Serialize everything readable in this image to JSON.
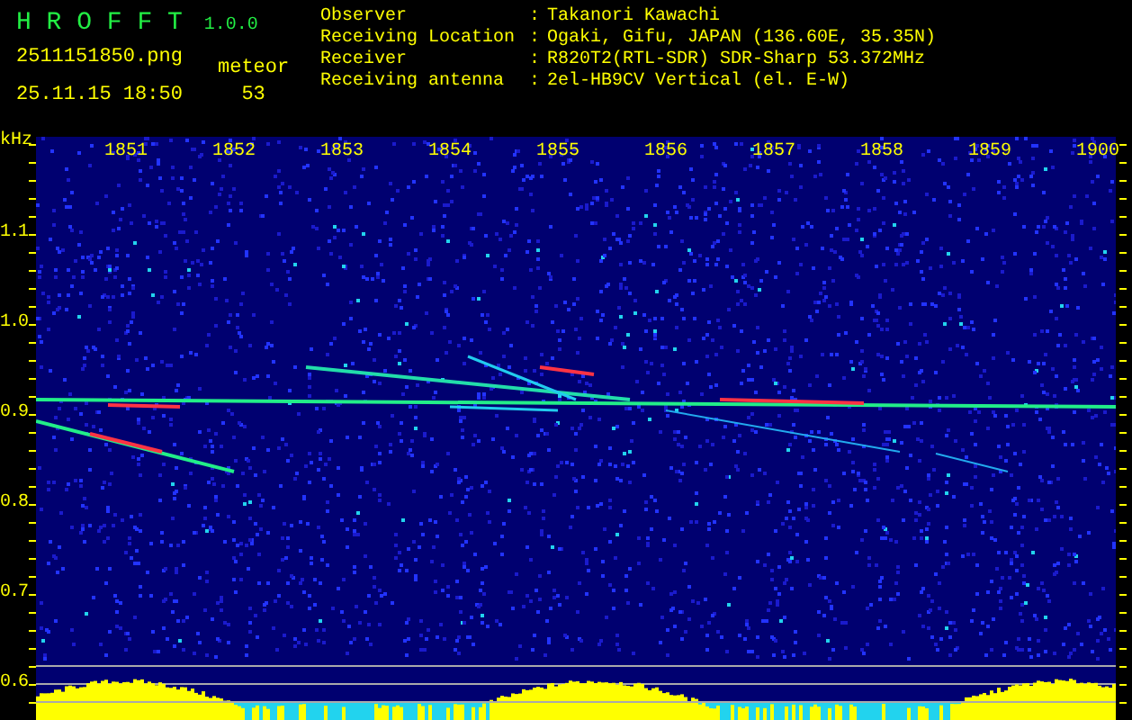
{
  "header": {
    "app_name": "H R O F F T",
    "version": "1.0.0",
    "filename": "2511151850.png",
    "datetime": "25.11.15 18:50",
    "meteor_label": "meteor",
    "meteor_count": "53"
  },
  "info": [
    {
      "label": "Observer",
      "separator": ":",
      "value": "Takanori Kawachi"
    },
    {
      "label": "Receiving Location",
      "separator": ":",
      "value": "Ogaki, Gifu, JAPAN (136.60E, 35.35N)"
    },
    {
      "label": "Receiver",
      "separator": ":",
      "value": "R820T2(RTL-SDR) SDR-Sharp 53.372MHz"
    },
    {
      "label": "Receiving antenna",
      "separator": ":",
      "value": "2el-HB9CV Vertical (el. E-W)"
    }
  ],
  "y_axis": {
    "unit": "kHz",
    "labels": [
      "1.1",
      "1.0",
      "0.9",
      "0.8",
      "0.7",
      "0.6"
    ]
  },
  "x_axis": {
    "labels": [
      "1851",
      "1852",
      "1853",
      "1854",
      "1855",
      "1856",
      "1857",
      "1858",
      "1859",
      "1900"
    ]
  }
}
